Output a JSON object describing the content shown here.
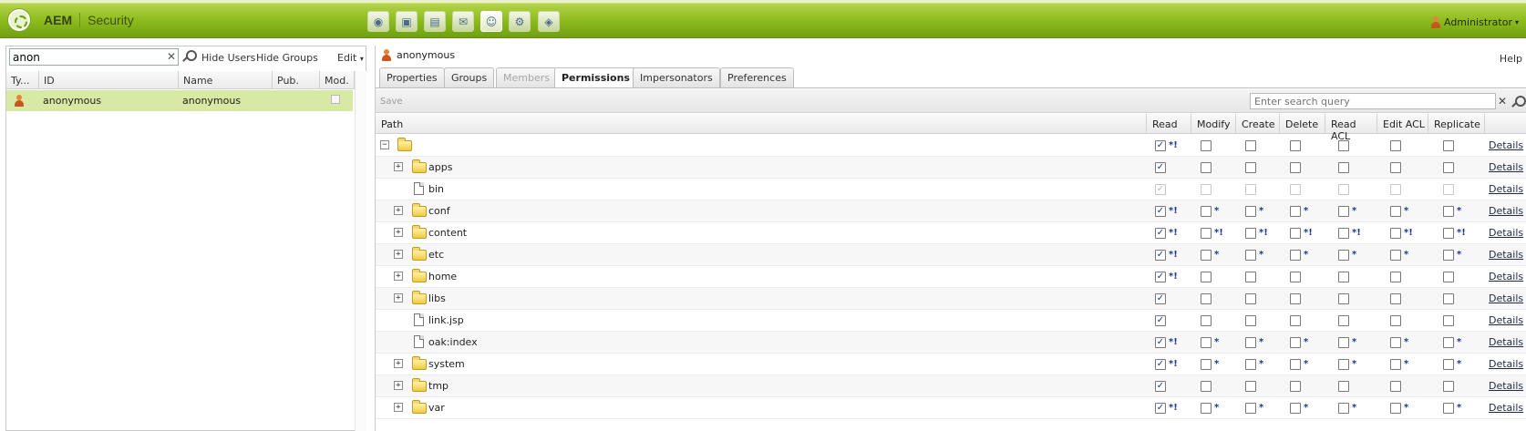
{
  "topbar": {
    "brand": "AEM",
    "section": "Security",
    "user": "Administrator",
    "tools": [
      {
        "name": "websites-icon",
        "glyph": "◉"
      },
      {
        "name": "dam-icon",
        "glyph": "▣"
      },
      {
        "name": "campaigns-icon",
        "glyph": "▤"
      },
      {
        "name": "inbox-icon",
        "glyph": "✉"
      },
      {
        "name": "users-icon",
        "glyph": "☺",
        "active": true
      },
      {
        "name": "tools-icon",
        "glyph": "⚙"
      },
      {
        "name": "tagging-icon",
        "glyph": "◈"
      }
    ]
  },
  "left": {
    "search_value": "anon",
    "hide_users": "Hide Users",
    "hide_groups": "Hide Groups",
    "edit": "Edit",
    "columns": [
      "Ty...",
      "ID",
      "Name",
      "Pub.",
      "Mod."
    ],
    "rows": [
      {
        "id": "anonymous",
        "name": "anonymous"
      }
    ]
  },
  "right": {
    "user": "anonymous",
    "help": "Help",
    "tabs": [
      "Properties",
      "Groups",
      "Members",
      "Permissions",
      "Impersonators",
      "Preferences"
    ],
    "active_tab": "Permissions",
    "save": "Save",
    "search_placeholder": "Enter search query",
    "columns": [
      "Path",
      "Read",
      "Modify",
      "Create",
      "Delete",
      "Read ACL",
      "Edit ACL",
      "Replicate"
    ],
    "details_label": "Details",
    "rows": [
      {
        "label": "",
        "type": "folder",
        "expander": "−",
        "indent": 0,
        "perms": [
          "x*!",
          "",
          "",
          "",
          "",
          "",
          ""
        ]
      },
      {
        "label": "apps",
        "type": "folder",
        "expander": "+",
        "indent": 1,
        "perms": [
          "x",
          "",
          "",
          "",
          "",
          "",
          ""
        ]
      },
      {
        "label": "bin",
        "type": "file",
        "expander": "",
        "indent": 1,
        "dim": true,
        "perms": [
          "x",
          "",
          "",
          "",
          "",
          "",
          ""
        ]
      },
      {
        "label": "conf",
        "type": "folder",
        "expander": "+",
        "indent": 1,
        "perms": [
          "x*!",
          "*",
          "*",
          "*",
          "*",
          "*",
          "*"
        ]
      },
      {
        "label": "content",
        "type": "folder",
        "expander": "+",
        "indent": 1,
        "perms": [
          "x*!",
          "*!",
          "*!",
          "*!",
          "*!",
          "*!",
          "*!"
        ]
      },
      {
        "label": "etc",
        "type": "folder",
        "expander": "+",
        "indent": 1,
        "perms": [
          "x*!",
          "*",
          "*",
          "*",
          "*",
          "*",
          "*"
        ]
      },
      {
        "label": "home",
        "type": "folder",
        "expander": "+",
        "indent": 1,
        "perms": [
          "x*!",
          "",
          "",
          "",
          "",
          "",
          ""
        ]
      },
      {
        "label": "libs",
        "type": "folder",
        "expander": "+",
        "indent": 1,
        "perms": [
          "x",
          "",
          "",
          "",
          "",
          "",
          ""
        ]
      },
      {
        "label": "link.jsp",
        "type": "file",
        "expander": "",
        "indent": 1,
        "perms": [
          "x",
          "",
          "",
          "",
          "",
          "",
          ""
        ]
      },
      {
        "label": "oak:index",
        "type": "file",
        "expander": "",
        "indent": 1,
        "perms": [
          "x*!",
          "*",
          "*",
          "*",
          "*",
          "*",
          "*"
        ]
      },
      {
        "label": "system",
        "type": "folder",
        "expander": "+",
        "indent": 1,
        "perms": [
          "x*!",
          "*",
          "*",
          "*",
          "*",
          "*",
          "*"
        ]
      },
      {
        "label": "tmp",
        "type": "folder",
        "expander": "+",
        "indent": 1,
        "perms": [
          "x",
          "",
          "",
          "",
          "",
          "",
          ""
        ]
      },
      {
        "label": "var",
        "type": "folder",
        "expander": "+",
        "indent": 1,
        "perms": [
          "x*!",
          "*",
          "*",
          "*",
          "*",
          "*",
          "*"
        ]
      }
    ]
  }
}
